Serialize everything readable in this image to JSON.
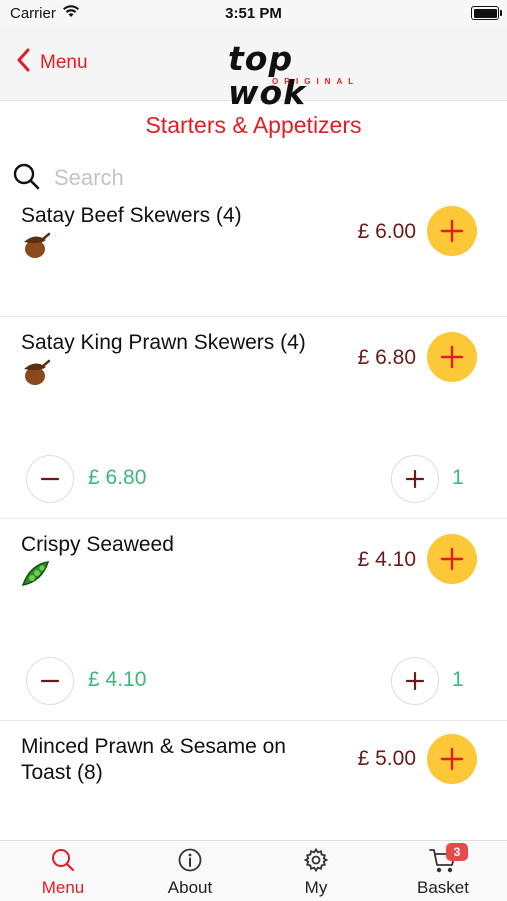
{
  "status_bar": {
    "carrier": "Carrier",
    "time": "3:51 PM"
  },
  "nav": {
    "back_label": "Menu",
    "logo_text": "top wok",
    "logo_sub": "ORIGINAL"
  },
  "section_title": "Starters & Appetizers",
  "search": {
    "placeholder": "Search"
  },
  "items": [
    {
      "name": "Satay Beef Skewers (4)",
      "price": "£ 6.00",
      "icon": "nut-icon"
    },
    {
      "name": "Satay King Prawn Skewers (4)",
      "price": "£ 6.80",
      "icon": "nut-icon",
      "selected_total": "£ 6.80",
      "quantity": "1"
    },
    {
      "name": "Crispy Seaweed",
      "price": "£ 4.10",
      "icon": "pea-pod-icon",
      "selected_total": "£ 4.10",
      "quantity": "1"
    },
    {
      "name": "Minced Prawn & Sesame on Toast (8)",
      "price": "£ 5.00"
    }
  ],
  "tabs": [
    {
      "label": "Menu",
      "icon": "search-icon",
      "active": true
    },
    {
      "label": "About",
      "icon": "info-icon",
      "active": false
    },
    {
      "label": "My",
      "icon": "gear-icon",
      "active": false
    },
    {
      "label": "Basket",
      "icon": "cart-icon",
      "active": false,
      "badge": "3"
    }
  ],
  "colors": {
    "brand_red": "#e41c23",
    "add_button": "#fcc838",
    "price": "#6b1a1a",
    "selected_green": "#3cb878"
  }
}
